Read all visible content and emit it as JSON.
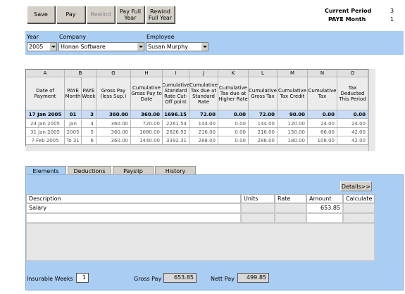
{
  "toolbar": {
    "save": "Save",
    "pay": "Pay",
    "rewind": "Rewind",
    "pay_full_year": "Pay Full\nYear",
    "rewind_full_year": "Rewind\nFull Year"
  },
  "period": {
    "current_label": "Current Period",
    "current_value": "3",
    "paye_label": "PAYE Month",
    "paye_value": "1"
  },
  "filters": {
    "year_label": "Year",
    "year_value": "2005",
    "company_label": "Company",
    "company_value": "Honan Software",
    "employee_label": "Employee",
    "employee_value": "Susan Murphy"
  },
  "grid": {
    "col_letters": [
      "A",
      "B",
      "G",
      "H",
      "I",
      "J",
      "K",
      "L",
      "M",
      "N",
      "O"
    ],
    "headers": [
      "Date of Payment",
      "PAYE Month",
      "PAYE Week",
      "Gross Pay (less Sup.)",
      "Cumulative Gross Pay to Date",
      "Cumulative Standard Rate Cut-Off point",
      "Cumulative Tax due at Standard Rate",
      "Cumulative Tax due at Higher Rate",
      "Cumulative Gross Tax",
      "Cumulative Tax Credit",
      "Cumulative Tax",
      "Tax Deducted This Period"
    ],
    "rows": [
      {
        "date": "17 Jan 2005",
        "month": "01",
        "week": "3",
        "values": [
          "360.00",
          "360.00",
          "1696.15",
          "72.00",
          "0.00",
          "72.00",
          "90.00",
          "0.00",
          "0.00"
        ]
      },
      {
        "date": "24 Jan 2005",
        "month": "Jan",
        "week": "4",
        "values": [
          "360.00",
          "720.00",
          "2261.54",
          "144.00",
          "0.00",
          "144.00",
          "120.00",
          "24.00",
          "24.00"
        ]
      },
      {
        "date": "31 Jan 2005",
        "month": "2005",
        "week": "5",
        "values": [
          "360.00",
          "1080.00",
          "2826.92",
          "216.00",
          "0.00",
          "216.00",
          "150.00",
          "66.00",
          "42.00"
        ]
      },
      {
        "date": "7 Feb 2005",
        "month": "To 31",
        "week": "6",
        "values": [
          "360.00",
          "1440.00",
          "3392.31",
          "288.00",
          "0.00",
          "288.00",
          "180.00",
          "108.00",
          "42.00"
        ]
      }
    ],
    "month_extra": "01"
  },
  "tabs": [
    "Elements",
    "Deductions",
    "Payslip",
    "History"
  ],
  "elements": {
    "details_button": "Details>>",
    "columns": [
      "Description",
      "Units",
      "Rate",
      "Amount",
      "Calculate"
    ],
    "rows": [
      {
        "description": "Salary",
        "units": "",
        "rate": "",
        "amount": "653.85",
        "calculate": ""
      }
    ]
  },
  "footer": {
    "insurable_weeks_label": "Insurable Weeks",
    "insurable_weeks_value": "1",
    "gross_pay_label": "Gross Pay",
    "gross_pay_value": "653.85",
    "nett_pay_label": "Nett Pay",
    "nett_pay_value": "499.85"
  }
}
